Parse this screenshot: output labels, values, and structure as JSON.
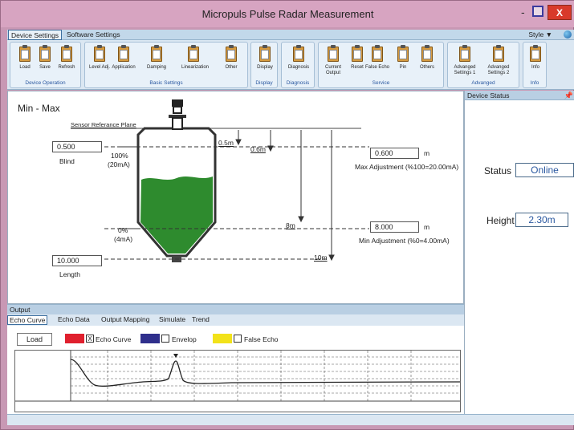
{
  "window": {
    "title": "Micropuls Pulse Radar Measurement",
    "close_label": "X",
    "minimize_label": "-"
  },
  "menu": {
    "tabs": [
      "Device Settings",
      "Software Settings"
    ],
    "style_label": "Style ▼"
  },
  "ribbon": {
    "groups": [
      {
        "label": "Device Operation",
        "buttons": [
          "Load",
          "Save",
          "Refresh"
        ]
      },
      {
        "label": "Basic Settings",
        "buttons": [
          "Level Adj.",
          "Application",
          "Damping",
          "Linearization",
          "Other"
        ]
      },
      {
        "label": "Display",
        "buttons": [
          "Display"
        ]
      },
      {
        "label": "Diagnosis",
        "buttons": [
          "Diagnosis"
        ]
      },
      {
        "label": "Service",
        "buttons": [
          "Current Output",
          "Reset",
          "False Echo",
          "Pin",
          "Others"
        ]
      },
      {
        "label": "Advanged",
        "buttons": [
          "Advanged Settings 1",
          "Advanged Settings 2"
        ]
      },
      {
        "label": "Info",
        "buttons": [
          "Info"
        ]
      }
    ]
  },
  "diagram": {
    "heading": "Min - Max",
    "sensor_ref_label": "Sensor Referance Plane",
    "blind_value": "0.500",
    "blind_label": "Blind",
    "pct100": "100%",
    "ma20": "(20mA)",
    "pct0": "0%",
    "ma4": "(4mA)",
    "length_value": "10.000",
    "length_label": "Length",
    "d05": "0.5m",
    "d06": "0.6m",
    "d8": "8m",
    "d10": "10m",
    "max_value": "0.600",
    "max_unit": "m",
    "max_label": "Max Adjustment (%100=20.00mA)",
    "min_value": "8.000",
    "min_unit": "m",
    "min_label": "Min Adjustment (%0=4.00mA)"
  },
  "device_status": {
    "header": "Device Status",
    "status_label": "Status",
    "status_value": "Online",
    "height_label": "Height",
    "height_value": "2.30m"
  },
  "output": {
    "header": "Output",
    "tabs": [
      "Echo Curve",
      "Echo Data",
      "Output Mapping",
      "Simulate",
      "Trend"
    ],
    "load_label": "Load",
    "legend": [
      {
        "label": "Echo Curve",
        "color": "#e0202e",
        "checked": true
      },
      {
        "label": "Envelop",
        "color": "#2f2f8c",
        "checked": false
      },
      {
        "label": "False Echo",
        "color": "#f2e21a",
        "checked": false
      }
    ]
  },
  "colors": {
    "liquid": "#2e8b2e",
    "accent": "#2a58a0"
  }
}
